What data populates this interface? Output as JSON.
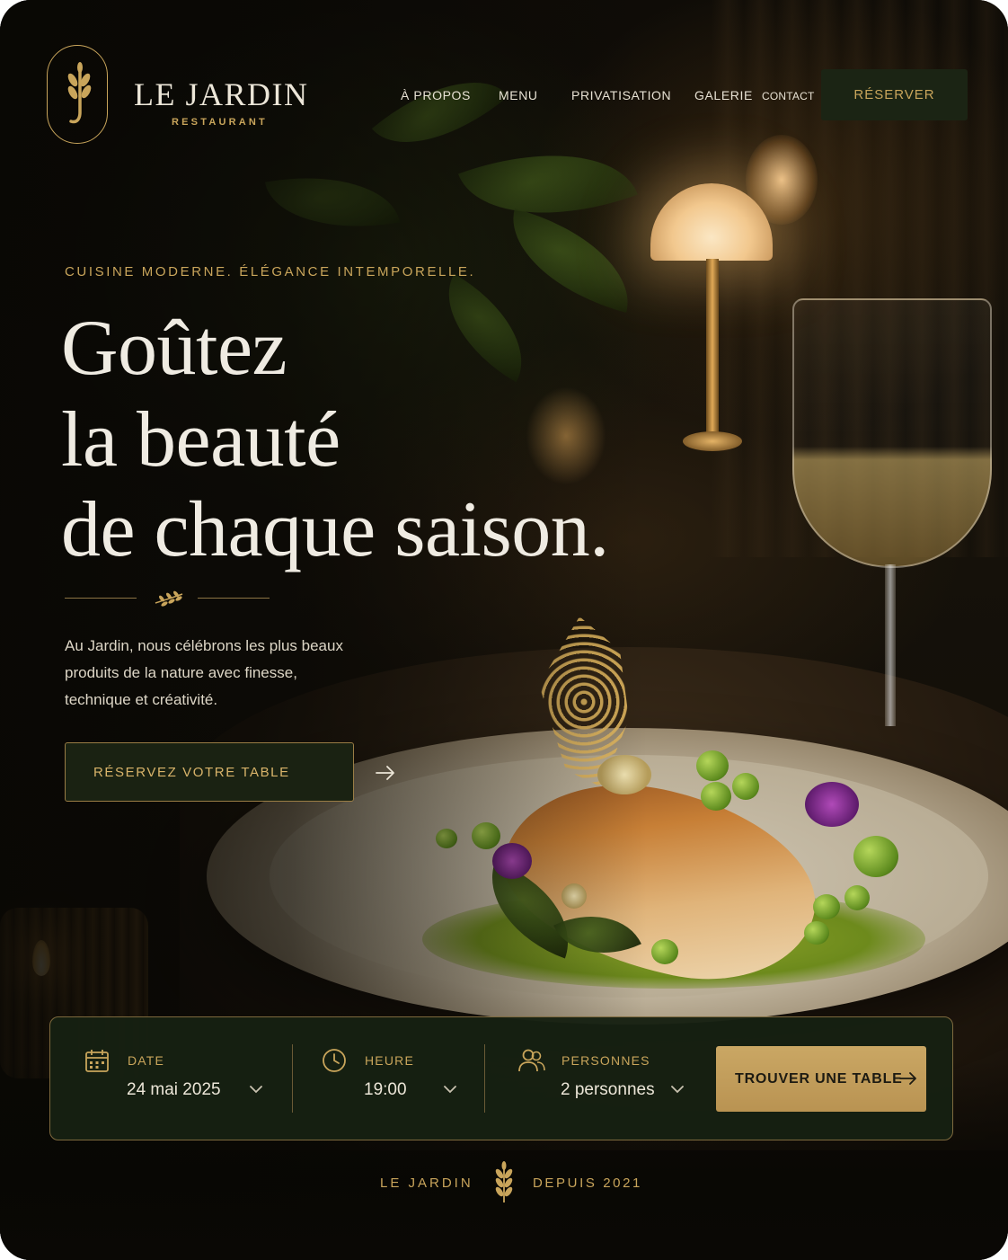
{
  "brand": {
    "name": "LE JARDIN",
    "subtitle": "RESTAURANT",
    "accent_color": "#c9a55b",
    "logo_icon": "wheat-sprig-icon"
  },
  "nav": {
    "items": [
      "À PROPOS",
      "MENU",
      "PRIVATISATION",
      "GALERIE",
      "CONTACT"
    ],
    "reserve_label": "RÉSERVER"
  },
  "hero": {
    "eyebrow": "CUISINE MODERNE. ÉLÉGANCE INTEMPORELLE.",
    "headline_lines": [
      "Goûtez",
      "la beauté",
      "de chaque saison."
    ],
    "intro": "Au Jardin, nous célébrons les plus beaux produits de la nature avec finesse, technique et créativité.",
    "cta_label": "RÉSERVEZ VOTRE TABLE",
    "cta_icon": "arrow-right-icon"
  },
  "booking": {
    "date": {
      "label": "DATE",
      "value": "24 mai 2025",
      "icon": "calendar-icon"
    },
    "time": {
      "label": "HEURE",
      "value": "19:00",
      "icon": "clock-icon"
    },
    "guests": {
      "label": "PERSONNES",
      "value": "2 personnes",
      "icon": "users-icon"
    },
    "submit_label": "TROUVER UNE TABLE"
  },
  "footer": {
    "left": "LE JARDIN",
    "right": "DEPUIS 2021"
  }
}
